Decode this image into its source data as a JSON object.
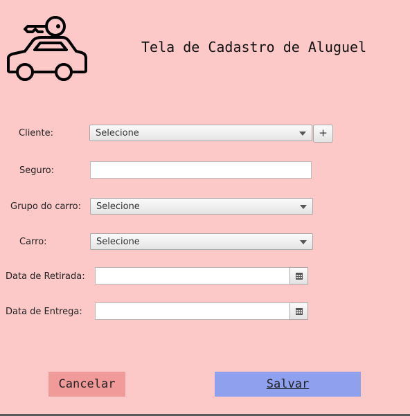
{
  "header": {
    "title": "Tela de Cadastro de Aluguel",
    "logo_icon": "car-key-icon"
  },
  "form": {
    "cliente": {
      "label": "Cliente:",
      "value": "Selecione",
      "add_button": "+"
    },
    "seguro": {
      "label": "Seguro:",
      "value": ""
    },
    "grupo_carro": {
      "label": "Grupo do carro:",
      "value": "Selecione"
    },
    "carro": {
      "label": "Carro:",
      "value": "Selecione"
    },
    "data_retirada": {
      "label": "Data de Retirada:",
      "value": "",
      "picker_icon": "calendar-icon"
    },
    "data_entrega": {
      "label": "Data de Entrega:",
      "value": "",
      "picker_icon": "calendar-icon"
    }
  },
  "actions": {
    "cancel_label": "Cancelar",
    "save_label": "Salvar"
  },
  "colors": {
    "background": "#fcc8c8",
    "cancel_button": "#f19a9a",
    "save_button": "#8fa0ee"
  }
}
